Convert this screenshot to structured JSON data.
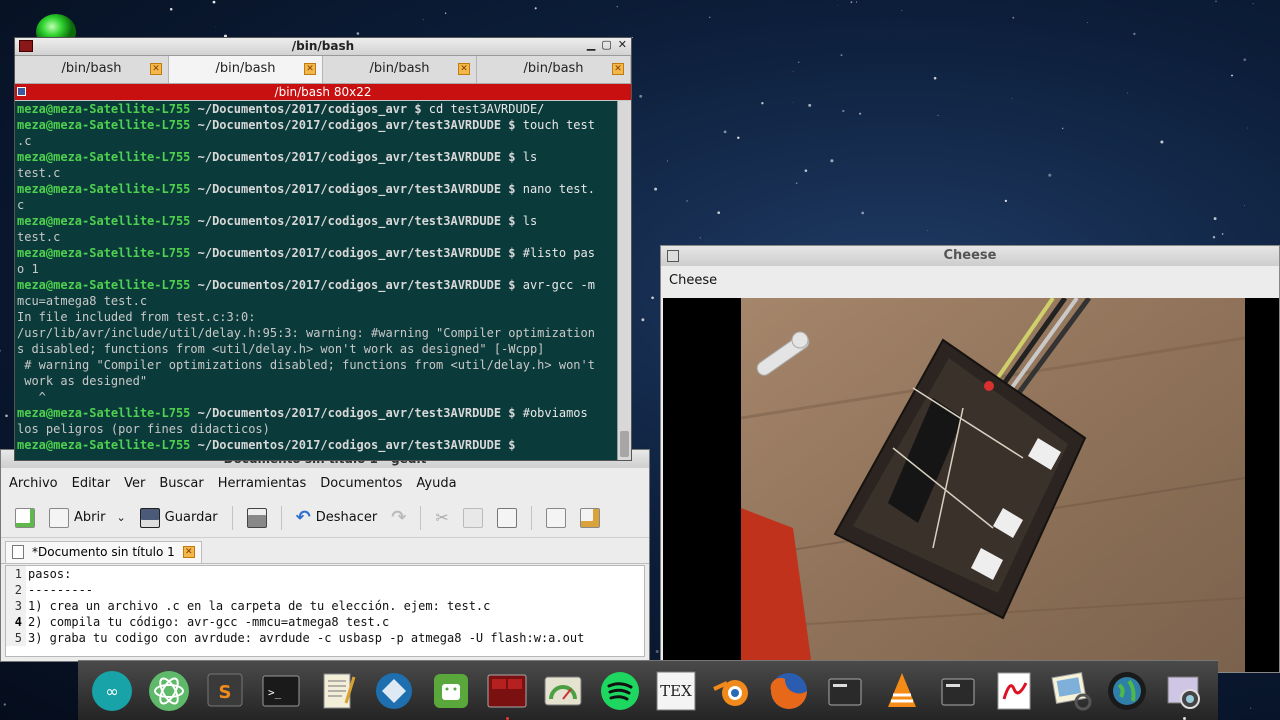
{
  "terminal": {
    "window_title": "/bin/bash",
    "tabs": [
      "/bin/bash",
      "/bin/bash",
      "/bin/bash",
      "/bin/bash"
    ],
    "active_tab": 1,
    "subtitle": "/bin/bash 80x22",
    "lines": [
      {
        "p": "meza@meza-Satellite-L755",
        "d": " ~/Documentos/2017/codigos_avr $",
        "c": " cd test3AVRDUDE/"
      },
      {
        "p": "meza@meza-Satellite-L755",
        "d": " ~/Documentos/2017/codigos_avr/test3AVRDUDE $",
        "c": " touch test"
      },
      {
        "t": ".c"
      },
      {
        "p": "meza@meza-Satellite-L755",
        "d": " ~/Documentos/2017/codigos_avr/test3AVRDUDE $",
        "c": " ls"
      },
      {
        "t": "test.c"
      },
      {
        "p": "meza@meza-Satellite-L755",
        "d": " ~/Documentos/2017/codigos_avr/test3AVRDUDE $",
        "c": " nano test."
      },
      {
        "t": "c"
      },
      {
        "p": "meza@meza-Satellite-L755",
        "d": " ~/Documentos/2017/codigos_avr/test3AVRDUDE $",
        "c": " ls"
      },
      {
        "t": "test.c"
      },
      {
        "p": "meza@meza-Satellite-L755",
        "d": " ~/Documentos/2017/codigos_avr/test3AVRDUDE $",
        "c": " #listo pas"
      },
      {
        "t": "o 1"
      },
      {
        "p": "meza@meza-Satellite-L755",
        "d": " ~/Documentos/2017/codigos_avr/test3AVRDUDE $",
        "c": " avr-gcc -m"
      },
      {
        "t": "mcu=atmega8 test.c"
      },
      {
        "t": "In file included from test.c:3:0:"
      },
      {
        "t": "/usr/lib/avr/include/util/delay.h:95:3: warning: #warning \"Compiler optimization"
      },
      {
        "t": "s disabled; functions from <util/delay.h> won't work as designed\" [-Wcpp]"
      },
      {
        "t": " # warning \"Compiler optimizations disabled; functions from <util/delay.h> won't"
      },
      {
        "t": " work as designed\""
      },
      {
        "t": "   ^"
      },
      {
        "p": "meza@meza-Satellite-L755",
        "d": " ~/Documentos/2017/codigos_avr/test3AVRDUDE $",
        "c": " #obviamos"
      },
      {
        "t": "los peligros (por fines didacticos)"
      },
      {
        "p": "meza@meza-Satellite-L755",
        "d": " ~/Documentos/2017/codigos_avr/test3AVRDUDE $",
        "c": ""
      }
    ]
  },
  "gedit": {
    "window_title": "Documento sin título 1 - gedit",
    "menu": [
      "Archivo",
      "Editar",
      "Ver",
      "Buscar",
      "Herramientas",
      "Documentos",
      "Ayuda"
    ],
    "toolbar": {
      "open": "Abrir",
      "save": "Guardar",
      "undo": "Deshacer"
    },
    "tab_label": "*Documento sin título 1",
    "lines": [
      {
        "n": "1",
        "text": "pasos:"
      },
      {
        "n": "2",
        "text": "---------"
      },
      {
        "n": "3",
        "text": "1) crea un archivo .c en la carpeta de tu elección. ejem: test.c"
      },
      {
        "n": "4",
        "text": "2) compila tu código: avr-gcc -mmcu=atmega8 test.c"
      },
      {
        "n": "5",
        "text": "3) graba tu codigo con avrdude: avrdude -c usbasp -p atmega8 -U flash:w:a.out"
      }
    ],
    "current_line": "4"
  },
  "cheese": {
    "window_title": "Cheese",
    "menu_label": "Cheese"
  },
  "dock": {
    "items": [
      "arduino-icon",
      "atom-icon",
      "sublime-text-icon",
      "terminal-icon",
      "text-editor-icon",
      "inkscape-icon",
      "android-studio-icon",
      "terminator-icon",
      "system-monitor-icon",
      "spotify-icon",
      "tex-icon",
      "blender-icon",
      "firefox-icon",
      "terminal-icon",
      "vlc-icon",
      "terminal-icon",
      "pdf-reader-icon",
      "image-viewer-icon",
      "globe-icon",
      "cheese-icon"
    ],
    "tex_label": "TEX"
  },
  "colors": {
    "terminal_bg": "#0b3a3a",
    "prompt_green": "#4ed14e",
    "subbar_red": "#c81010"
  }
}
